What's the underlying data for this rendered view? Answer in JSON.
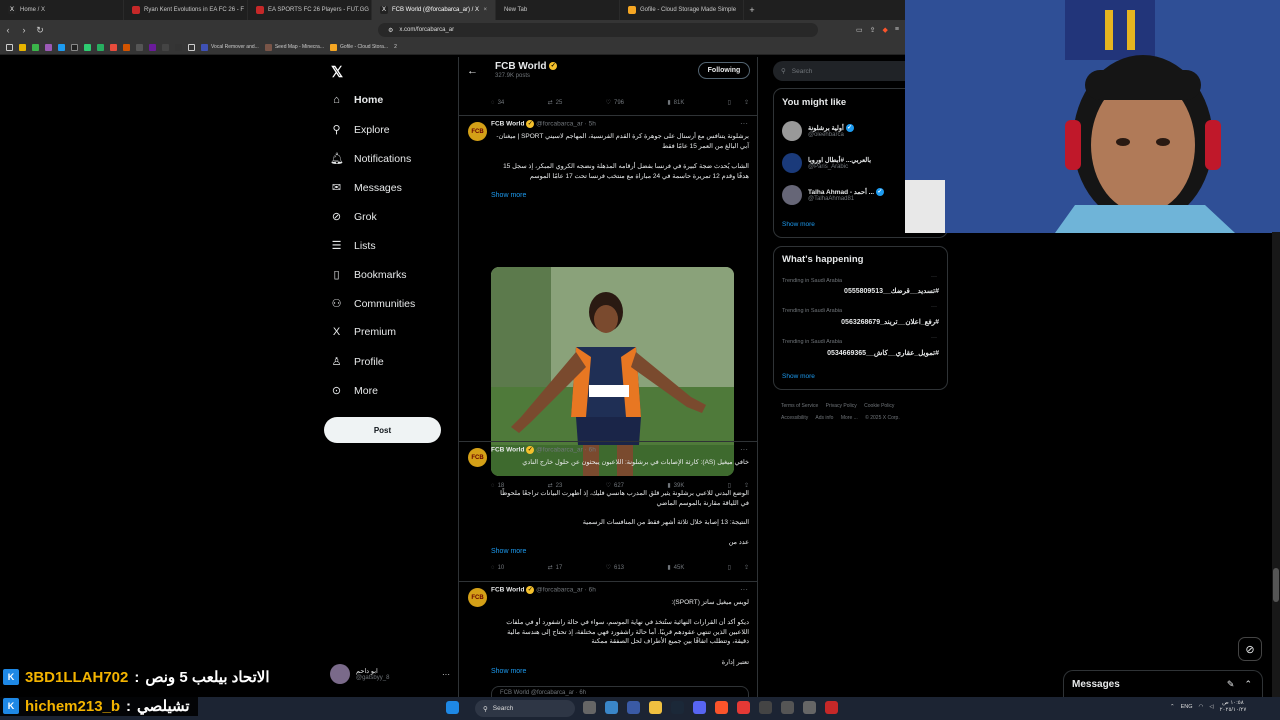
{
  "browser": {
    "tabs": [
      {
        "title": "Home / X",
        "color": "#222"
      },
      {
        "title": "Ryan Kent Evolutions in EA FC 26 - F",
        "color": "#c62828"
      },
      {
        "title": "EA SPORTS FC 26 Players - FUT.GG",
        "color": "#c62828"
      },
      {
        "title": "FCB World (@forcabarca_ar) / X",
        "color": "#222",
        "active": true
      },
      {
        "title": "New Tab",
        "color": "#333"
      },
      {
        "title": "Gofile - Cloud Storage Made Simple",
        "color": "#f5a623"
      }
    ],
    "address": "x.com/forcabarca_ar",
    "bookmarks": [
      "Vocal Remover and...",
      "Seed Map - Minecra...",
      "Gofile - Cloud Stora...",
      "2"
    ]
  },
  "nav": {
    "items": [
      {
        "label": "Home",
        "icon": "home-icon",
        "glyph": "⌂"
      },
      {
        "label": "Explore",
        "icon": "search-icon",
        "glyph": "⚲"
      },
      {
        "label": "Notifications",
        "icon": "bell-icon",
        "glyph": "🔔︎"
      },
      {
        "label": "Messages",
        "icon": "mail-icon",
        "glyph": "✉"
      },
      {
        "label": "Grok",
        "icon": "grok-icon",
        "glyph": "⊘"
      },
      {
        "label": "Lists",
        "icon": "list-icon",
        "glyph": "☰"
      },
      {
        "label": "Bookmarks",
        "icon": "bookmark-icon",
        "glyph": "▯"
      },
      {
        "label": "Communities",
        "icon": "communities-icon",
        "glyph": "⚇"
      },
      {
        "label": "Premium",
        "icon": "x-premium-icon",
        "glyph": "X"
      },
      {
        "label": "Profile",
        "icon": "profile-icon",
        "glyph": "♙"
      },
      {
        "label": "More",
        "icon": "more-icon",
        "glyph": "⊙"
      }
    ],
    "post_label": "Post",
    "account": {
      "name": "ابو داحم",
      "handle": "@gatsbyy_8"
    }
  },
  "profile_header": {
    "name": "FCB World",
    "posts": "327.9K posts",
    "follow_label": "Following"
  },
  "tweets": [
    {
      "partial": true,
      "stats": {
        "replies": "34",
        "reposts": "25",
        "likes": "796",
        "views": "81K"
      }
    },
    {
      "name": "FCB World",
      "handle": "@forcabarca_ar",
      "time": "· 5h",
      "text1": "برشلونة يتنافس مع أرسنال على جوهرة كرة القدم الفرنسية، المهاجم لاسيني SPORT | ميغنان-آبي البالغ من العمر 15 عامًا فقط",
      "text2": "الشاب يُحدث ضجة كبيرة في فرنسا بفضل أرقامه المذهلة ونضجه الكروي المبكر، إذ سجل 15 هدفًا وقدم 12 تمريرة حاسمة في 24 مباراة مع منتخب فرنسا تحت 17 عامًا الموسم",
      "show_more": "Show more",
      "stats": {
        "replies": "18",
        "reposts": "23",
        "likes": "627",
        "views": "39K"
      }
    },
    {
      "name": "FCB World",
      "handle": "@forcabarca_ar",
      "time": "· 6h",
      "text1": "خافي ميغيل (AS): كارثة الإصابات في برشلونة: اللاعبون يبحثون عن حلول خارج النادي",
      "text2": "الوضع البدني للاعبي برشلونة يثير قلق المدرب هانسي فليك، إذ أظهرت البيانات تراجعًا ملحوظًا في اللياقة مقارنة بالموسم الماضي",
      "text3": "النتيجة: 13 إصابة خلال ثلاثة أشهر فقط من المنافسات الرسمية",
      "text4": "عدد من",
      "show_more": "Show more",
      "stats": {
        "replies": "10",
        "reposts": "17",
        "likes": "613",
        "views": "45K"
      }
    },
    {
      "name": "FCB World",
      "handle": "@forcabarca_ar",
      "time": "· 6h",
      "text1": "لويس ميغيل ساتز (SPORT):",
      "text2": "ديكو أكد أن القرارات النهائية ستُتخذ في نهاية الموسم، سواء في حالة راشفورد أو في ملفات اللاعبين الذين تنتهي عقودهم قريبًا. أما حالة راشفورد فهي مختلفة، إذ تحتاج إلى هندسة مالية دقيقة، وتتطلب اتفاقًا بين جميع الأطراف لحل الصفقة ممكنة",
      "text3": "تعتبر إدارة",
      "show_more": "Show more",
      "quoted": "FCB World @forcabarca_ar · 6h"
    }
  ],
  "right": {
    "search_placeholder": "Search",
    "who_to_follow": {
      "title": "You might like",
      "users": [
        {
          "name": "أولية برشلونة",
          "handle": "@oleehbarca",
          "color": "#888"
        },
        {
          "name": "بالعربي... #أبطال اوروبا",
          "handle": "@Paris_Arabic",
          "color": "#1a3a7a"
        },
        {
          "name": "Talha Ahmad - أحمد ...",
          "handle": "@TalhaAhmad81",
          "color": "#667"
        }
      ],
      "show_more": "Show more"
    },
    "trending": {
      "title": "What's happening",
      "items": [
        {
          "context": "Trending in Saudi Arabia",
          "tag": "#تسديد__قرضك__0555809513"
        },
        {
          "context": "Trending in Saudi Arabia",
          "tag": "#رفع_اعلان__تريند_0563268679"
        },
        {
          "context": "Trending in Saudi Arabia",
          "tag": "#تمويل_عقاري__كاش__0534669365"
        }
      ],
      "show_more": "Show more"
    },
    "footer": [
      "Terms of Service",
      "Privacy Policy",
      "Cookie Policy",
      "Accessibility",
      "Ads info",
      "More ...",
      "© 2025 X Corp."
    ]
  },
  "messages_drawer": {
    "label": "Messages"
  },
  "chat_overlay": [
    {
      "user": "3BD1LLAH702",
      "sep": ":",
      "message": "الاتحاد بيلعب 5 ونص"
    },
    {
      "user": "hichem213_b",
      "sep": ":",
      "message": "تشيلصي"
    }
  ],
  "taskbar": {
    "search_label": "Search",
    "lang": "ENG",
    "time": "١٠:٥٨ ص",
    "date": "٢٠٢٥/١٠/٢٧"
  },
  "colors": {
    "accent": "#1d9bf0",
    "background": "#000000",
    "border": "#2f3336",
    "chat_user": "#f4b400"
  }
}
